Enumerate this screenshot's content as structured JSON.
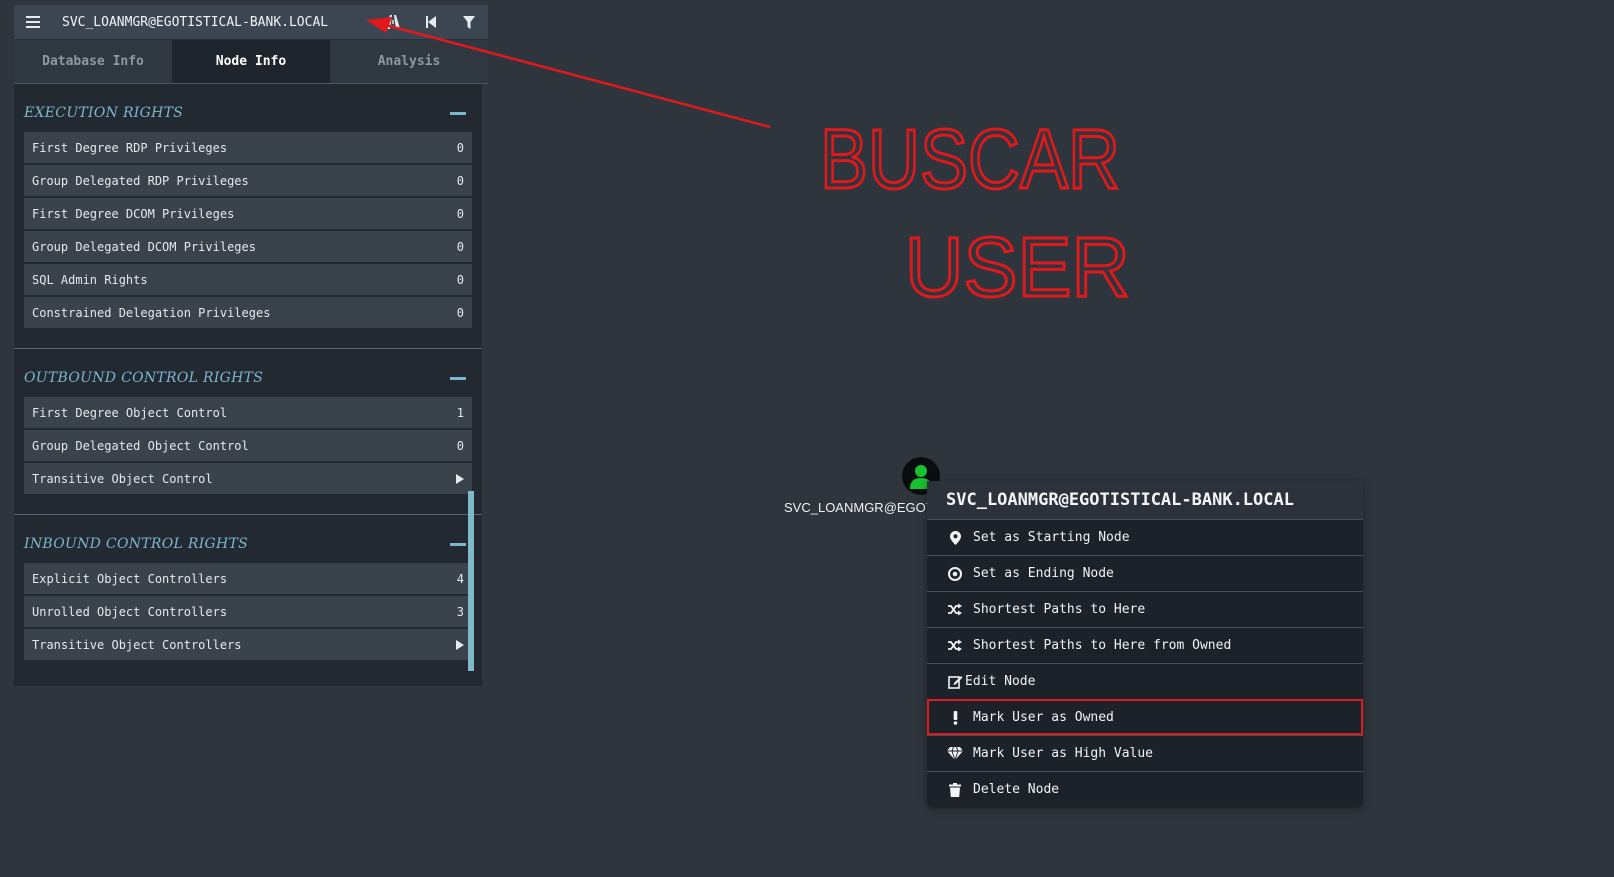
{
  "search": {
    "value": "SVC_LOANMGR@EGOTISTICAL-BANK.LOCAL"
  },
  "tabs": [
    {
      "label": "Database Info"
    },
    {
      "label": "Node Info"
    },
    {
      "label": "Analysis"
    }
  ],
  "sections": [
    {
      "title": "EXECUTION RIGHTS",
      "rows": [
        {
          "label": "First Degree RDP Privileges",
          "value": "0"
        },
        {
          "label": "Group Delegated RDP Privileges",
          "value": "0"
        },
        {
          "label": "First Degree DCOM Privileges",
          "value": "0"
        },
        {
          "label": "Group Delegated DCOM Privileges",
          "value": "0"
        },
        {
          "label": "SQL Admin Rights",
          "value": "0"
        },
        {
          "label": "Constrained Delegation Privileges",
          "value": "0"
        }
      ]
    },
    {
      "title": "OUTBOUND CONTROL RIGHTS",
      "rows": [
        {
          "label": "First Degree Object Control",
          "value": "1"
        },
        {
          "label": "Group Delegated Object Control",
          "value": "0"
        },
        {
          "label": "Transitive Object Control",
          "value": ""
        }
      ]
    },
    {
      "title": "INBOUND CONTROL RIGHTS",
      "rows": [
        {
          "label": "Explicit Object Controllers",
          "value": "4"
        },
        {
          "label": "Unrolled Object Controllers",
          "value": "3"
        },
        {
          "label": "Transitive Object Controllers",
          "value": ""
        }
      ]
    }
  ],
  "node": {
    "label": "SVC_LOANMGR@EGOTISTICAL-BANK.LOCAL"
  },
  "context_menu": {
    "title": "SVC_LOANMGR@EGOTISTICAL-BANK.LOCAL",
    "items": [
      {
        "label": "Set as Starting Node",
        "icon": "map-marker-icon"
      },
      {
        "label": "Set as Ending Node",
        "icon": "bullseye-icon"
      },
      {
        "label": "Shortest Paths to Here",
        "icon": "random-icon"
      },
      {
        "label": "Shortest Paths to Here from Owned",
        "icon": "random-icon"
      },
      {
        "label": "Edit Node",
        "icon": "edit-icon"
      },
      {
        "label": "Mark User as Owned",
        "icon": "exclamation-icon",
        "highlighted": true
      },
      {
        "label": "Mark User as High Value",
        "icon": "gem-icon"
      },
      {
        "label": "Delete Node",
        "icon": "trash-icon"
      }
    ]
  },
  "annotation": {
    "text_line1": "BUSCAR",
    "text_line2": "USER",
    "color": "#e0191c"
  },
  "colors": {
    "accent": "#7bb7cc",
    "highlight": "#e0191c",
    "node_user": "#18c130"
  }
}
